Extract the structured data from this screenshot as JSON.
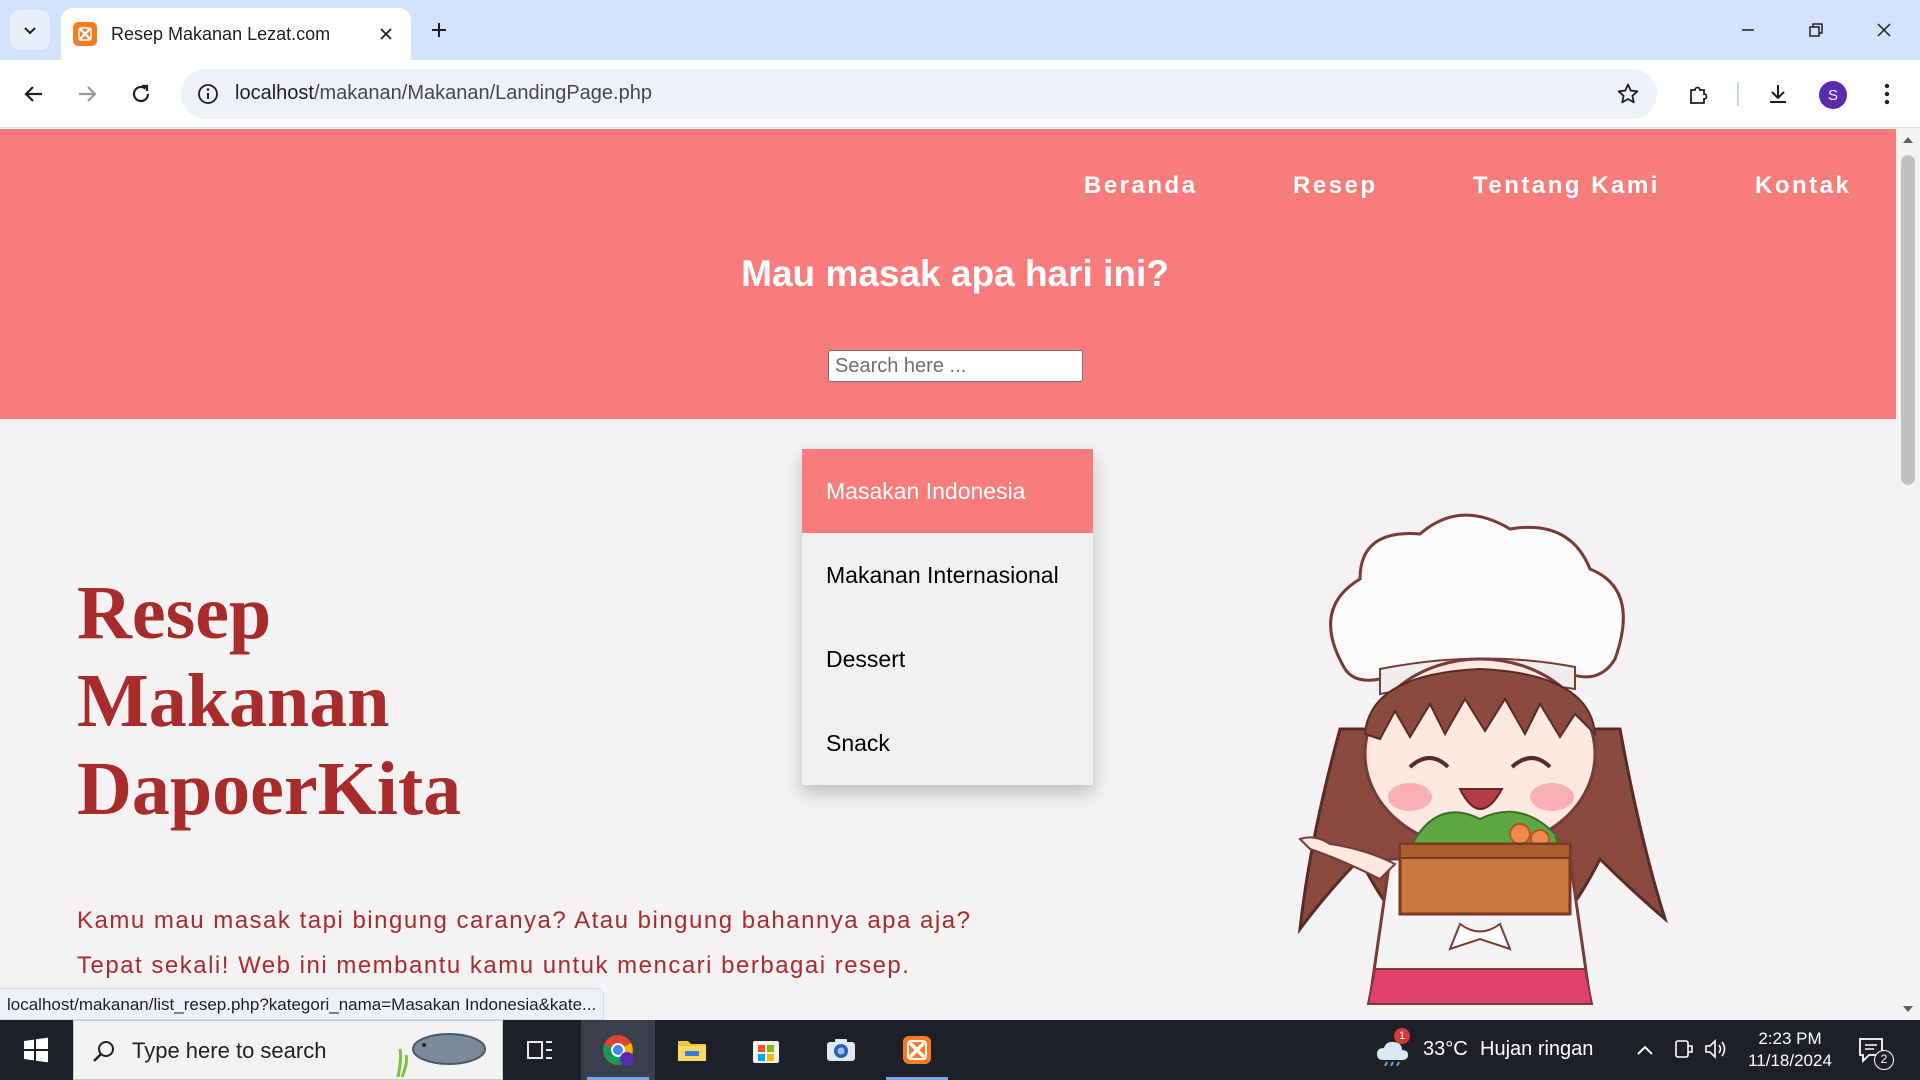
{
  "browser": {
    "tab_title": "Resep Makanan Lezat.com",
    "url_host": "localhost",
    "url_path": "/makanan/Makanan/LandingPage.php",
    "profile_initial": "S",
    "status_url": "localhost/makanan/list_resep.php?kategori_nama=Masakan Indonesia&kate..."
  },
  "site": {
    "nav": [
      "Beranda",
      "Resep",
      "Tentang Kami",
      "Kontak"
    ],
    "header_title": "Mau masak apa hari ini?",
    "search_placeholder": "Search here ...",
    "categories": [
      "Masakan Indonesia",
      "Makanan Internasional",
      "Dessert",
      "Snack"
    ],
    "active_category": "Masakan Indonesia",
    "hero_title_lines": [
      "Resep",
      "Makanan",
      "DapoerKita"
    ],
    "hero_text_lines": [
      "Kamu mau masak tapi bingung caranya? Atau bingung bahannya apa aja?",
      "Tepat sekali! Web ini membantu kamu untuk mencari berbagai resep."
    ]
  },
  "taskbar": {
    "search_placeholder": "Type here to search",
    "weather_badge": "1",
    "temperature": "33°C",
    "weather_desc": "Hujan ringan",
    "time": "2:23 PM",
    "date": "11/18/2024",
    "notification_count": "2"
  },
  "colors": {
    "header_bg": "#f87c7c",
    "hero_text": "#a82c2c",
    "page_bg": "#f4f2f2",
    "tabstrip_bg": "#d3e3fd"
  }
}
